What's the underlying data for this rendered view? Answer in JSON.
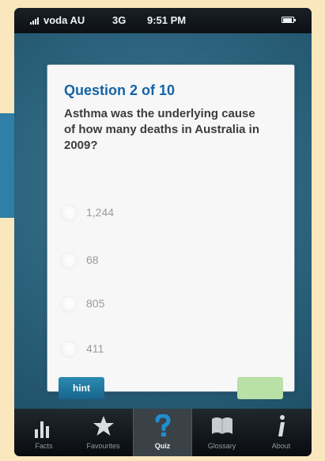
{
  "status_bar": {
    "carrier": "voda AU",
    "network": "3G",
    "time": "9:51 PM"
  },
  "quiz": {
    "question_number": "Question 2 of 10",
    "question_text": "Asthma was the underlying cause of how many deaths in Australia in 2009?",
    "options": [
      {
        "label": "1,244"
      },
      {
        "label": "68"
      },
      {
        "label": "805"
      },
      {
        "label": "411"
      }
    ],
    "hint_label": "hint"
  },
  "tabs": [
    {
      "label": "Facts",
      "icon": "bar-chart-icon"
    },
    {
      "label": "Favourites",
      "icon": "star-icon"
    },
    {
      "label": "Quiz",
      "icon": "question-mark-icon",
      "active": true
    },
    {
      "label": "Glossary",
      "icon": "book-icon"
    },
    {
      "label": "About",
      "icon": "info-icon"
    }
  ],
  "colors": {
    "question_blue": "#1664a5",
    "hint_button": "#1e7ca6",
    "next_button_disabled": "#b8e0a7",
    "screen_background": "#2f6781",
    "outer_background": "#fbe7bd"
  }
}
